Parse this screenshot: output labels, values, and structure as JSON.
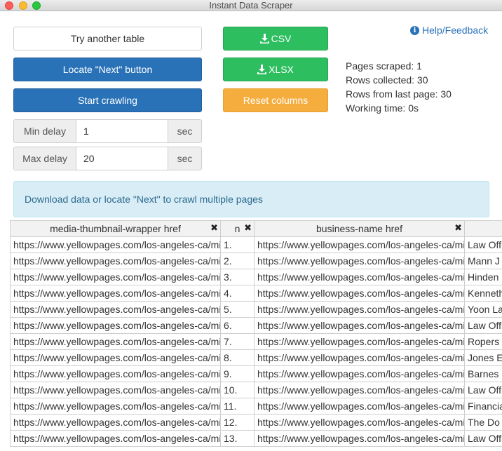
{
  "window": {
    "title": "Instant Data Scraper"
  },
  "buttons": {
    "try_another": "Try another table",
    "locate_next": "Locate \"Next\" button",
    "start_crawling": "Start crawling",
    "csv": "CSV",
    "xlsx": "XLSX",
    "reset_columns": "Reset columns",
    "download_icon": "download-icon"
  },
  "help": {
    "label": "Help/Feedback",
    "icon": "info-icon"
  },
  "stats": {
    "pages_scraped": "Pages scraped: 1",
    "rows_collected": "Rows collected: 30",
    "rows_last_page": "Rows from last page: 30",
    "working_time": "Working time: 0s"
  },
  "min_delay": {
    "label": "Min delay",
    "value": "1",
    "unit": "sec"
  },
  "max_delay": {
    "label": "Max delay",
    "value": "20",
    "unit": "sec"
  },
  "alert": {
    "text": "Download data or locate \"Next\" to crawl multiple pages"
  },
  "table": {
    "headers": [
      "media-thumbnail-wrapper href",
      "n",
      "business-name href",
      ""
    ],
    "remove_glyph": "✖",
    "rows": [
      [
        "https://www.yellowpages.com/los-angeles-ca/mip",
        "1.",
        "https://www.yellowpages.com/los-angeles-ca/mip",
        "Law Offices"
      ],
      [
        "https://www.yellowpages.com/los-angeles-ca/mip",
        "2.",
        "https://www.yellowpages.com/los-angeles-ca/mip",
        "Mann J"
      ],
      [
        "https://www.yellowpages.com/los-angeles-ca/mip",
        "3.",
        "https://www.yellowpages.com/los-angeles-ca/mip",
        "Hinden"
      ],
      [
        "https://www.yellowpages.com/los-angeles-ca/mip",
        "4.",
        "https://www.yellowpages.com/los-angeles-ca/mip",
        "Kenneth"
      ],
      [
        "https://www.yellowpages.com/los-angeles-ca/mip",
        "5.",
        "https://www.yellowpages.com/los-angeles-ca/mip",
        "Yoon La"
      ],
      [
        "https://www.yellowpages.com/los-angeles-ca/mip",
        "6.",
        "https://www.yellowpages.com/los-angeles-ca/mip",
        "Law Offi"
      ],
      [
        "https://www.yellowpages.com/los-angeles-ca/mip",
        "7.",
        "https://www.yellowpages.com/los-angeles-ca/mip",
        "Ropers"
      ],
      [
        "https://www.yellowpages.com/los-angeles-ca/mip",
        "8.",
        "https://www.yellowpages.com/los-angeles-ca/mip",
        "Jones E"
      ],
      [
        "https://www.yellowpages.com/los-angeles-ca/mip",
        "9.",
        "https://www.yellowpages.com/los-angeles-ca/mip",
        "Barnes"
      ],
      [
        "https://www.yellowpages.com/los-angeles-ca/mip",
        "10.",
        "https://www.yellowpages.com/los-angeles-ca/mip",
        "Law Offi"
      ],
      [
        "https://www.yellowpages.com/los-angeles-ca/mip",
        "11.",
        "https://www.yellowpages.com/los-angeles-ca/mip",
        "Financia"
      ],
      [
        "https://www.yellowpages.com/los-angeles-ca/mip",
        "12.",
        "https://www.yellowpages.com/los-angeles-ca/mip",
        "The Do"
      ],
      [
        "https://www.yellowpages.com/los-angeles-ca/mip",
        "13.",
        "https://www.yellowpages.com/los-angeles-ca/mip",
        "Law Offi"
      ]
    ]
  }
}
